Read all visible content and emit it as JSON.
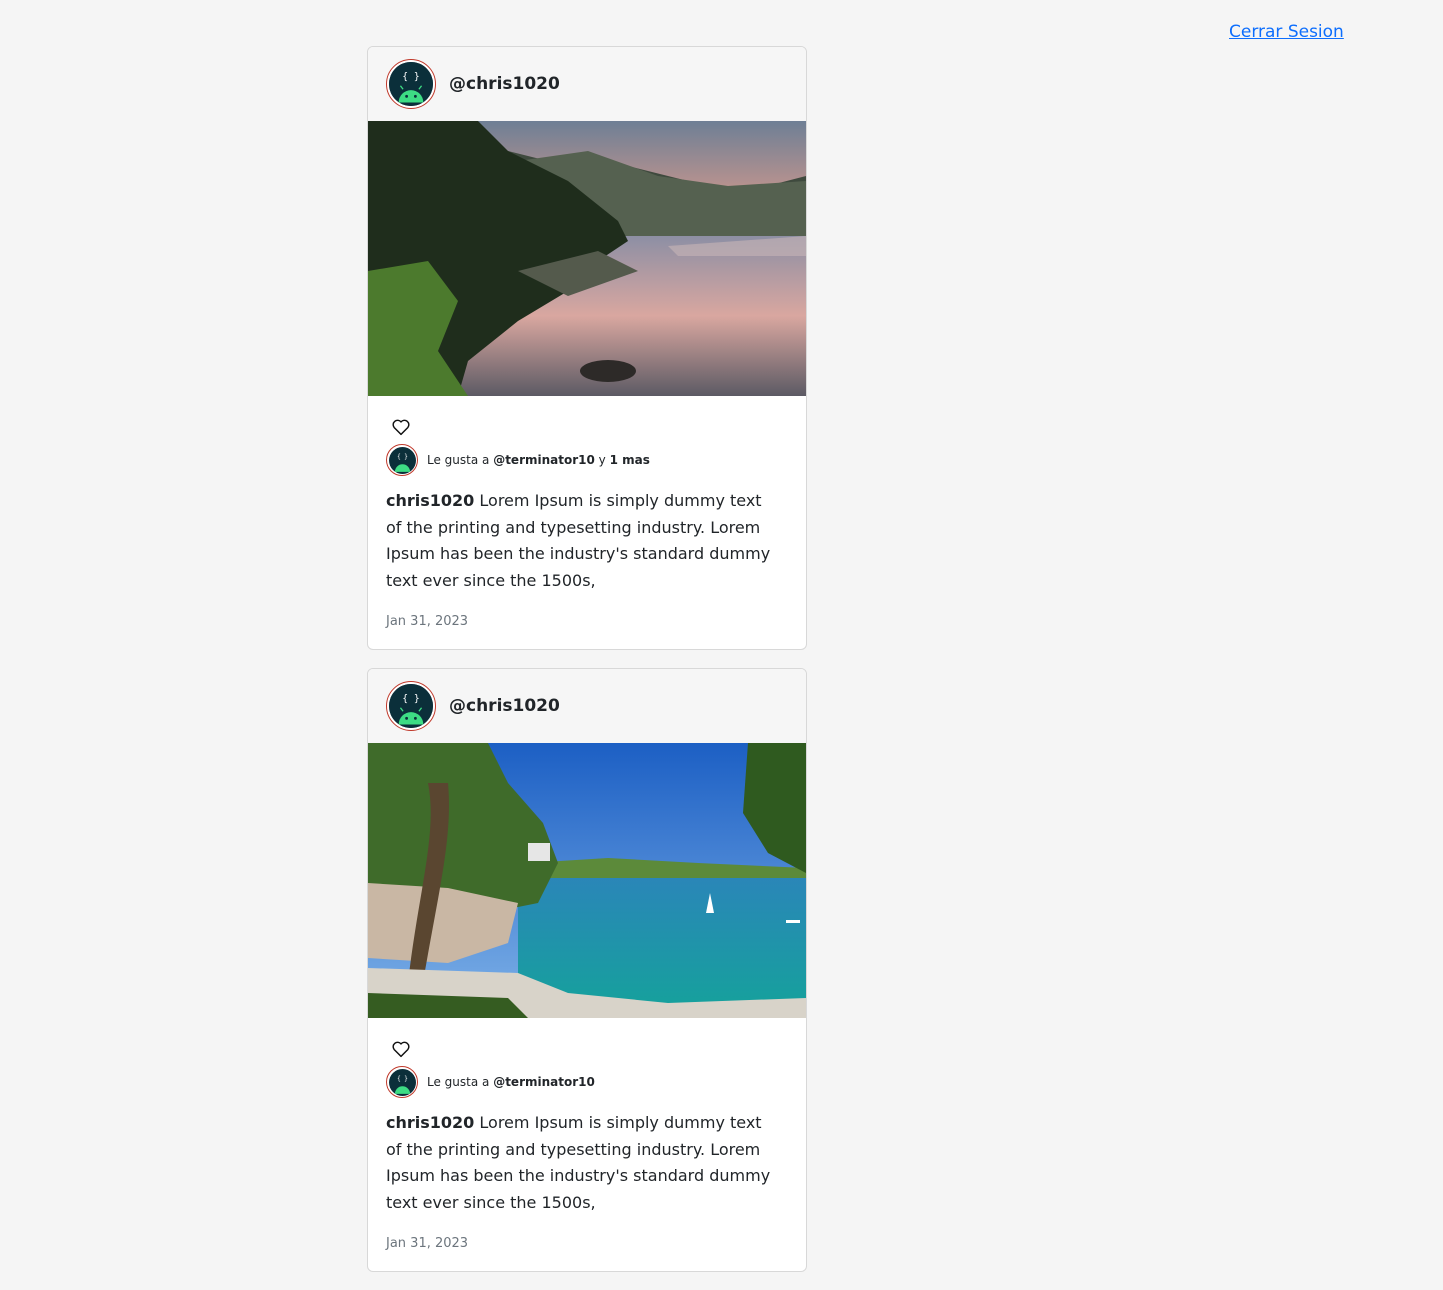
{
  "header": {
    "logout_label": "Cerrar Sesion"
  },
  "posts": [
    {
      "author_handle": "@chris1020",
      "image_desc": "lake-sunset-photo",
      "likes_prefix": "Le gusta a ",
      "likes_user": "@terminator10",
      "likes_join": " y ",
      "likes_more": "1 mas",
      "caption_user": "chris1020",
      "caption_text": " Lorem Ipsum is simply dummy text of the printing and typesetting industry. Lorem Ipsum has been the industry's standard dummy text ever since the 1500s,",
      "date": "Jan 31, 2023"
    },
    {
      "author_handle": "@chris1020",
      "image_desc": "coastal-bay-photo",
      "likes_prefix": "Le gusta a ",
      "likes_user": "@terminator10",
      "likes_join": "",
      "likes_more": "",
      "caption_user": "chris1020",
      "caption_text": " Lorem Ipsum is simply dummy text of the printing and typesetting industry. Lorem Ipsum has been the industry's standard dummy text ever since the 1500s,",
      "date": "Jan 31, 2023"
    }
  ],
  "colors": {
    "link": "#0d6efd",
    "avatar_bg": "#0b2f3a",
    "android_green": "#3ddc84",
    "avatar_ring": "#c0392b"
  }
}
